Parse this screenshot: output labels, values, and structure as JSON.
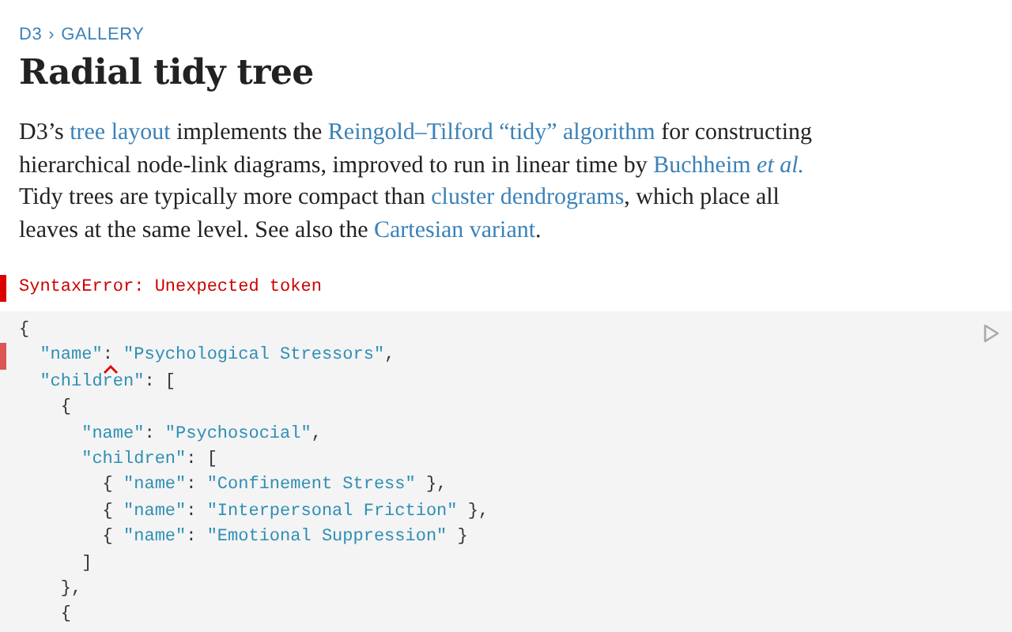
{
  "breadcrumb": [
    {
      "text": "D3"
    },
    {
      "text": "GALLERY"
    }
  ],
  "breadcrumb_separator": "›",
  "title": "Radial tidy tree",
  "paragraph": [
    {
      "kind": "text",
      "text": "D3’s "
    },
    {
      "kind": "link",
      "text": "tree layout"
    },
    {
      "kind": "text",
      "text": " implements the "
    },
    {
      "kind": "link",
      "text": "Reingold–Tilford “tidy” algorithm"
    },
    {
      "kind": "text",
      "text": " for constructing hierarchical node-link diagrams, improved to run in linear time by "
    },
    {
      "kind": "link",
      "text": "Buchheim *et al.*"
    },
    {
      "kind": "text",
      "text": " Tidy trees are typically more compact than "
    },
    {
      "kind": "link",
      "text": "cluster dendrograms"
    },
    {
      "kind": "text",
      "text": ", which place all leaves at the same level. See also the "
    },
    {
      "kind": "link",
      "text": "Cartesian variant"
    },
    {
      "kind": "text",
      "text": "."
    }
  ],
  "error_message": "SyntaxError: Unexpected token",
  "code_lines": [
    {
      "error": false,
      "tokens": [
        {
          "kind": "punct",
          "text": "{"
        }
      ]
    },
    {
      "error": true,
      "tokens": [
        {
          "kind": "string",
          "text": "  \"name\""
        },
        {
          "kind": "punct",
          "text": ":",
          "error": true
        },
        {
          "kind": "string",
          "text": " \"Psychological Stressors\""
        },
        {
          "kind": "punct",
          "text": ","
        }
      ]
    },
    {
      "error": false,
      "tokens": [
        {
          "kind": "string",
          "text": "  \"children\""
        },
        {
          "kind": "punct",
          "text": ": ["
        }
      ]
    },
    {
      "error": false,
      "tokens": [
        {
          "kind": "punct",
          "text": "    {"
        }
      ]
    },
    {
      "error": false,
      "tokens": [
        {
          "kind": "string",
          "text": "      \"name\""
        },
        {
          "kind": "punct",
          "text": ": "
        },
        {
          "kind": "string",
          "text": "\"Psychosocial\""
        },
        {
          "kind": "punct",
          "text": ","
        }
      ]
    },
    {
      "error": false,
      "tokens": [
        {
          "kind": "string",
          "text": "      \"children\""
        },
        {
          "kind": "punct",
          "text": ": ["
        }
      ]
    },
    {
      "error": false,
      "tokens": [
        {
          "kind": "punct",
          "text": "        { "
        },
        {
          "kind": "string",
          "text": "\"name\""
        },
        {
          "kind": "punct",
          "text": ": "
        },
        {
          "kind": "string",
          "text": "\"Confinement Stress\""
        },
        {
          "kind": "punct",
          "text": " },"
        }
      ]
    },
    {
      "error": false,
      "tokens": [
        {
          "kind": "punct",
          "text": "        { "
        },
        {
          "kind": "string",
          "text": "\"name\""
        },
        {
          "kind": "punct",
          "text": ": "
        },
        {
          "kind": "string",
          "text": "\"Interpersonal Friction\""
        },
        {
          "kind": "punct",
          "text": " },"
        }
      ]
    },
    {
      "error": false,
      "tokens": [
        {
          "kind": "punct",
          "text": "        { "
        },
        {
          "kind": "string",
          "text": "\"name\""
        },
        {
          "kind": "punct",
          "text": ": "
        },
        {
          "kind": "string",
          "text": "\"Emotional Suppression\""
        },
        {
          "kind": "punct",
          "text": " }"
        }
      ]
    },
    {
      "error": false,
      "tokens": [
        {
          "kind": "punct",
          "text": "      ]"
        }
      ]
    },
    {
      "error": false,
      "tokens": [
        {
          "kind": "punct",
          "text": "    },"
        }
      ]
    },
    {
      "error": false,
      "tokens": [
        {
          "kind": "punct",
          "text": "    {"
        }
      ]
    }
  ]
}
